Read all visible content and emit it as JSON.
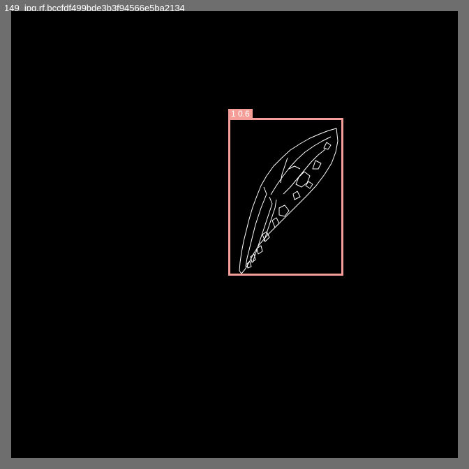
{
  "window": {
    "title": "149_jpg.rf.bccfdf499bde3b3f94566e5ba2134"
  },
  "annotation": {
    "label": "1 0.6",
    "box_color": "#f59e98"
  },
  "colors": {
    "frame": "#6e6e6e",
    "canvas": "#000000",
    "edges": "#ffffff"
  }
}
